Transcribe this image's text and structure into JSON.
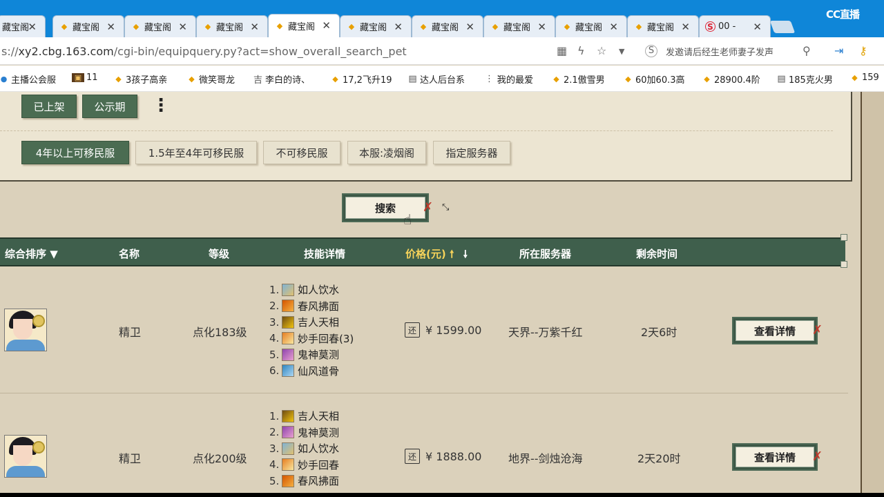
{
  "browser": {
    "tabs": [
      {
        "label": "藏宝阁",
        "icon": "chicken-icon"
      },
      {
        "label": "藏宝阁",
        "icon": "chicken-icon"
      },
      {
        "label": "藏宝阁",
        "icon": "chicken-icon"
      },
      {
        "label": "藏宝阁",
        "icon": "chicken-icon"
      },
      {
        "label": "藏宝阁",
        "icon": "chicken-icon"
      },
      {
        "label": "藏宝阁",
        "icon": "chicken-icon"
      },
      {
        "label": "藏宝阁",
        "icon": "chicken-icon"
      },
      {
        "label": "藏宝阁",
        "icon": "chicken-icon"
      },
      {
        "label": "藏宝阁",
        "icon": "chicken-icon"
      },
      {
        "label": "藏宝阁",
        "icon": "chicken-icon"
      },
      {
        "label": "00 -",
        "icon": "sogou-icon"
      }
    ],
    "active_tab_index": 4,
    "brand": "CC直播",
    "url_prefix": "s://",
    "url_host": "xy2.cbg.163.com",
    "url_path": "/cgi-bin/equipquery.py?act=show_overall_search_pet",
    "search_hint": "发邀请后经生老师妻子发声",
    "bookmarks": [
      {
        "label": "主播公会服",
        "icon": "globe-icon"
      },
      {
        "label": "11",
        "icon": "game-icon"
      },
      {
        "label": "3孩子高亲",
        "icon": "chicken-icon"
      },
      {
        "label": "微笑哥龙",
        "icon": "chicken-icon"
      },
      {
        "label": "李白的诗、",
        "icon": "ji-icon"
      },
      {
        "label": "17,2飞升19",
        "icon": "chicken-icon"
      },
      {
        "label": "达人后台系",
        "icon": "doc-icon"
      },
      {
        "label": "我的最爱",
        "icon": "grid-icon"
      },
      {
        "label": "2.1傲雪男",
        "icon": "chicken-icon"
      },
      {
        "label": "60加60.3高",
        "icon": "chicken-icon"
      },
      {
        "label": "28900.4阶",
        "icon": "chicken-icon"
      },
      {
        "label": "185克火男",
        "icon": "doc-icon"
      },
      {
        "label": "159",
        "icon": "chicken-icon"
      }
    ]
  },
  "filters": {
    "status_buttons": [
      "已上架",
      "公示期"
    ],
    "migrate_buttons": [
      "4年以上可移民服",
      "1.5年至4年可移民服",
      "不可移民服",
      "本服:凌烟阁",
      "指定服务器"
    ],
    "active_migrate_index": 0
  },
  "search_button": "搜索",
  "table": {
    "headers": {
      "sort": "综合排序",
      "name": "名称",
      "level": "等级",
      "skills": "技能详情",
      "price": "价格(元)",
      "server": "所在服务器",
      "time": "剩余时间"
    },
    "rows": [
      {
        "name": "精卫",
        "level": "点化183级",
        "skills": [
          "1.",
          "如人饮水",
          "2.",
          "春风拂面",
          "3.",
          "吉人天相",
          "4.",
          "妙手回春(3)",
          "5.",
          "鬼神莫测",
          "6.",
          "仙风道骨"
        ],
        "price_badge": "还",
        "price": "¥ 1599.00",
        "server": "天界--万紫千红",
        "time": "2天6时",
        "detail": "查看详情"
      },
      {
        "name": "精卫",
        "level": "点化200级",
        "skills": [
          "1.",
          "吉人天相",
          "2.",
          "鬼神莫测",
          "3.",
          "如人饮水",
          "4.",
          "妙手回春",
          "5.",
          "春风拂面"
        ],
        "price_badge": "还",
        "price": "¥ 1888.00",
        "server": "地界--剑烛沧海",
        "time": "2天20时",
        "detail": "查看详情"
      }
    ]
  },
  "colors": {
    "tabstrip": "#0f86d8",
    "green_button": "#4b6c52",
    "table_header": "#3f5f4c",
    "price_header": "#f7d35a",
    "page_bg": "#dbd1bb"
  }
}
